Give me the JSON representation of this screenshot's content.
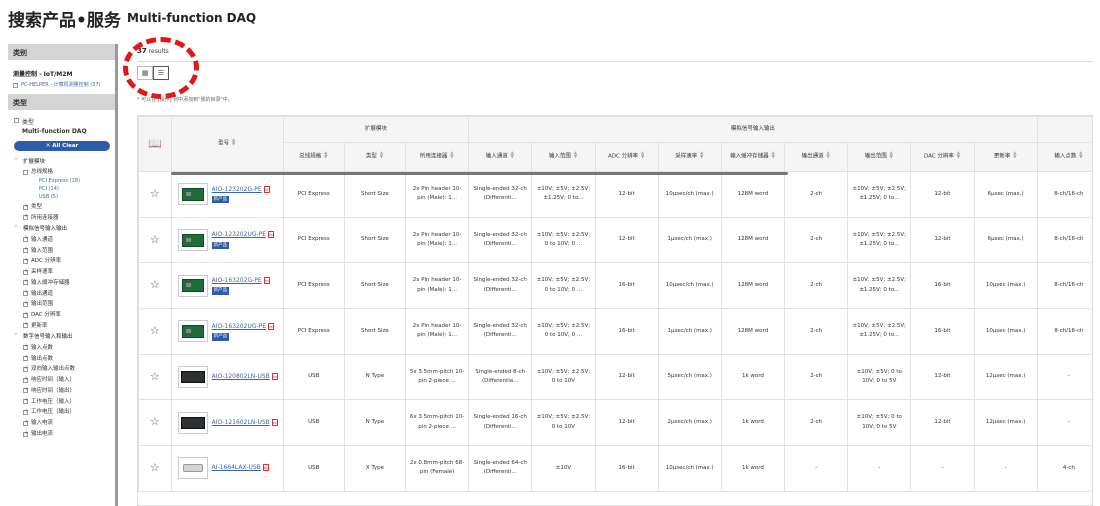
{
  "page": {
    "title_zh": "搜索产品•服务",
    "title_en": "Multi-function DAQ"
  },
  "sidebar": {
    "category_header": "类别",
    "category": "测量控制 - IoT/M2M",
    "category_sub": "PC-HELPER - 计算机测量控制 (37)",
    "type_header": "类型",
    "type_label": "类型",
    "type_value": "Multi-function DAQ",
    "clear_label": "✕ All Clear",
    "groups": [
      {
        "label": "扩展模块",
        "items": [
          {
            "label": "总线规格",
            "subs": [
              "PCI Express (18)",
              "PCI (14)",
              "USB (5)"
            ]
          },
          {
            "label": "类型",
            "subs": []
          },
          {
            "label": "所用连接器",
            "subs": []
          }
        ]
      },
      {
        "label": "模拟信号输入输出",
        "items": [
          {
            "label": "输入通道"
          },
          {
            "label": "输入范围"
          },
          {
            "label": "ADC 分辨率"
          },
          {
            "label": "采样速率"
          },
          {
            "label": "输入缓冲存储器"
          },
          {
            "label": "输出通道"
          },
          {
            "label": "输出范围"
          },
          {
            "label": "DAC 分辨率"
          },
          {
            "label": "更新率"
          }
        ]
      },
      {
        "label": "数字信号输入和输出",
        "items": [
          {
            "label": "输入点数"
          },
          {
            "label": "输出点数"
          },
          {
            "label": "双向输入输出点数"
          },
          {
            "label": "响应时间（输入）"
          },
          {
            "label": "响应时间（输出）"
          },
          {
            "label": "工作电压（输入）"
          },
          {
            "label": "工作电压（输出）"
          },
          {
            "label": "输入电流"
          },
          {
            "label": "输出电流"
          }
        ]
      }
    ]
  },
  "results": {
    "count": "37",
    "count_suffix": "results",
    "note": "* 可以在 [操作] 列中添加到\"我的目录\"中。"
  },
  "table": {
    "group_headers": {
      "expansion": "扩展模块",
      "analog": "模拟信号输入输出"
    },
    "columns": [
      "型号",
      "总线规格",
      "类型",
      "所用连接器",
      "输入通道",
      "输入范围",
      "ADC 分辨率",
      "采样速率",
      "输入缓冲存储器",
      "输出通道",
      "输出范围",
      "DAC 分辨率",
      "更新率",
      "输入点数"
    ],
    "new_badge": "新产品",
    "rows": [
      {
        "model": "AIO-123202G-PE",
        "new": true,
        "img": "pcb",
        "cells": [
          "PCI Express",
          "Short Size",
          "2x Pin header 10-pin (Male): 1...",
          "Single-ended 32-ch (Differenti...",
          "±10V; ±5V; ±2.5V; ±1.25V; 0 to...",
          "12-bit",
          "10μsec/ch (max.)",
          "128M word",
          "2-ch",
          "±10V; ±5V; ±2.5V; ±1.25V; 0 to...",
          "12-bit",
          "6μsec (max.)",
          "8-ch/16-ch"
        ]
      },
      {
        "model": "AIO-123202UG-PE",
        "new": true,
        "img": "pcb",
        "cells": [
          "PCI Express",
          "Short Size",
          "2x Pin header 10-pin (Male): 1...",
          "Single-ended 32-ch (Differenti...",
          "±10V; ±5V; ±2.5V; 0 to 10V; 0 ...",
          "12-bit",
          "1μsec/ch (max.)",
          "128M word",
          "2-ch",
          "±10V; ±5V; ±2.5V; ±1.25V; 0 to...",
          "12-bit",
          "6μsec (max.)",
          "8-ch/16-ch"
        ]
      },
      {
        "model": "AIO-163202G-PE",
        "new": true,
        "img": "pcb",
        "cells": [
          "PCI Express",
          "Short Size",
          "2x Pin header 10-pin (Male): 1...",
          "Single-ended 32-ch (Differenti...",
          "±10V; ±5V; ±2.5V; 0 to 10V; 0 ...",
          "16-bit",
          "10μsec/ch (max.)",
          "128M word",
          "2-ch",
          "±10V; ±5V; ±2.5V; ±1.25V; 0 to...",
          "16-bit",
          "10μsec (max.)",
          "8-ch/16-ch"
        ]
      },
      {
        "model": "AIO-163202UG-PE",
        "new": true,
        "img": "pcb",
        "cells": [
          "PCI Express",
          "Short Size",
          "2x Pin header 10-pin (Male): 1...",
          "Single-ended 32-ch (Differenti...",
          "±10V; ±5V; ±2.5V; 0 to 10V; 0 ...",
          "16-bit",
          "1μsec/ch (max.)",
          "128M word",
          "2-ch",
          "±10V; ±5V; ±2.5V; ±1.25V; 0 to...",
          "16-bit",
          "10μsec (max.)",
          "8-ch/16-ch"
        ]
      },
      {
        "model": "AIO-120802LN-USB",
        "new": false,
        "img": "box",
        "cells": [
          "USB",
          "N Type",
          "5x 3.5mm-pitch 10-pin 2-piece ...",
          "Single-ended 8-ch (Differentia...",
          "±10V; ±5V; ±2.5V; 0 to 10V",
          "12-bit",
          "5μsec/ch (max.)",
          "1k word",
          "2-ch",
          "±10V; ±5V; 0 to 10V; 0 to 5V",
          "12-bit",
          "12μsec (max.)",
          "-"
        ]
      },
      {
        "model": "AIO-121602LN-USB",
        "new": false,
        "img": "box",
        "cells": [
          "USB",
          "N Type",
          "6x 3.5mm-pitch 10-pin 2-piece ...",
          "Single-ended 16-ch (Differenti...",
          "±10V; ±5V; ±2.5V; 0 to 10V",
          "12-bit",
          "2μsec/ch (max.)",
          "1k word",
          "2-ch",
          "±10V; ±5V; 0 to 10V; 0 to 5V",
          "12-bit",
          "12μsec (max.)",
          "-"
        ]
      },
      {
        "model": "AI-1664LAX-USB",
        "new": false,
        "img": "cable",
        "cells": [
          "USB",
          "X Type",
          "2x 0.8mm-pitch 68-pin (Female)",
          "Single-ended 64-ch (Differenti...",
          "±10V",
          "16-bit",
          "10μsec/ch (max.)",
          "1k word",
          "-",
          "-",
          "-",
          "-",
          "4-ch"
        ]
      }
    ]
  }
}
